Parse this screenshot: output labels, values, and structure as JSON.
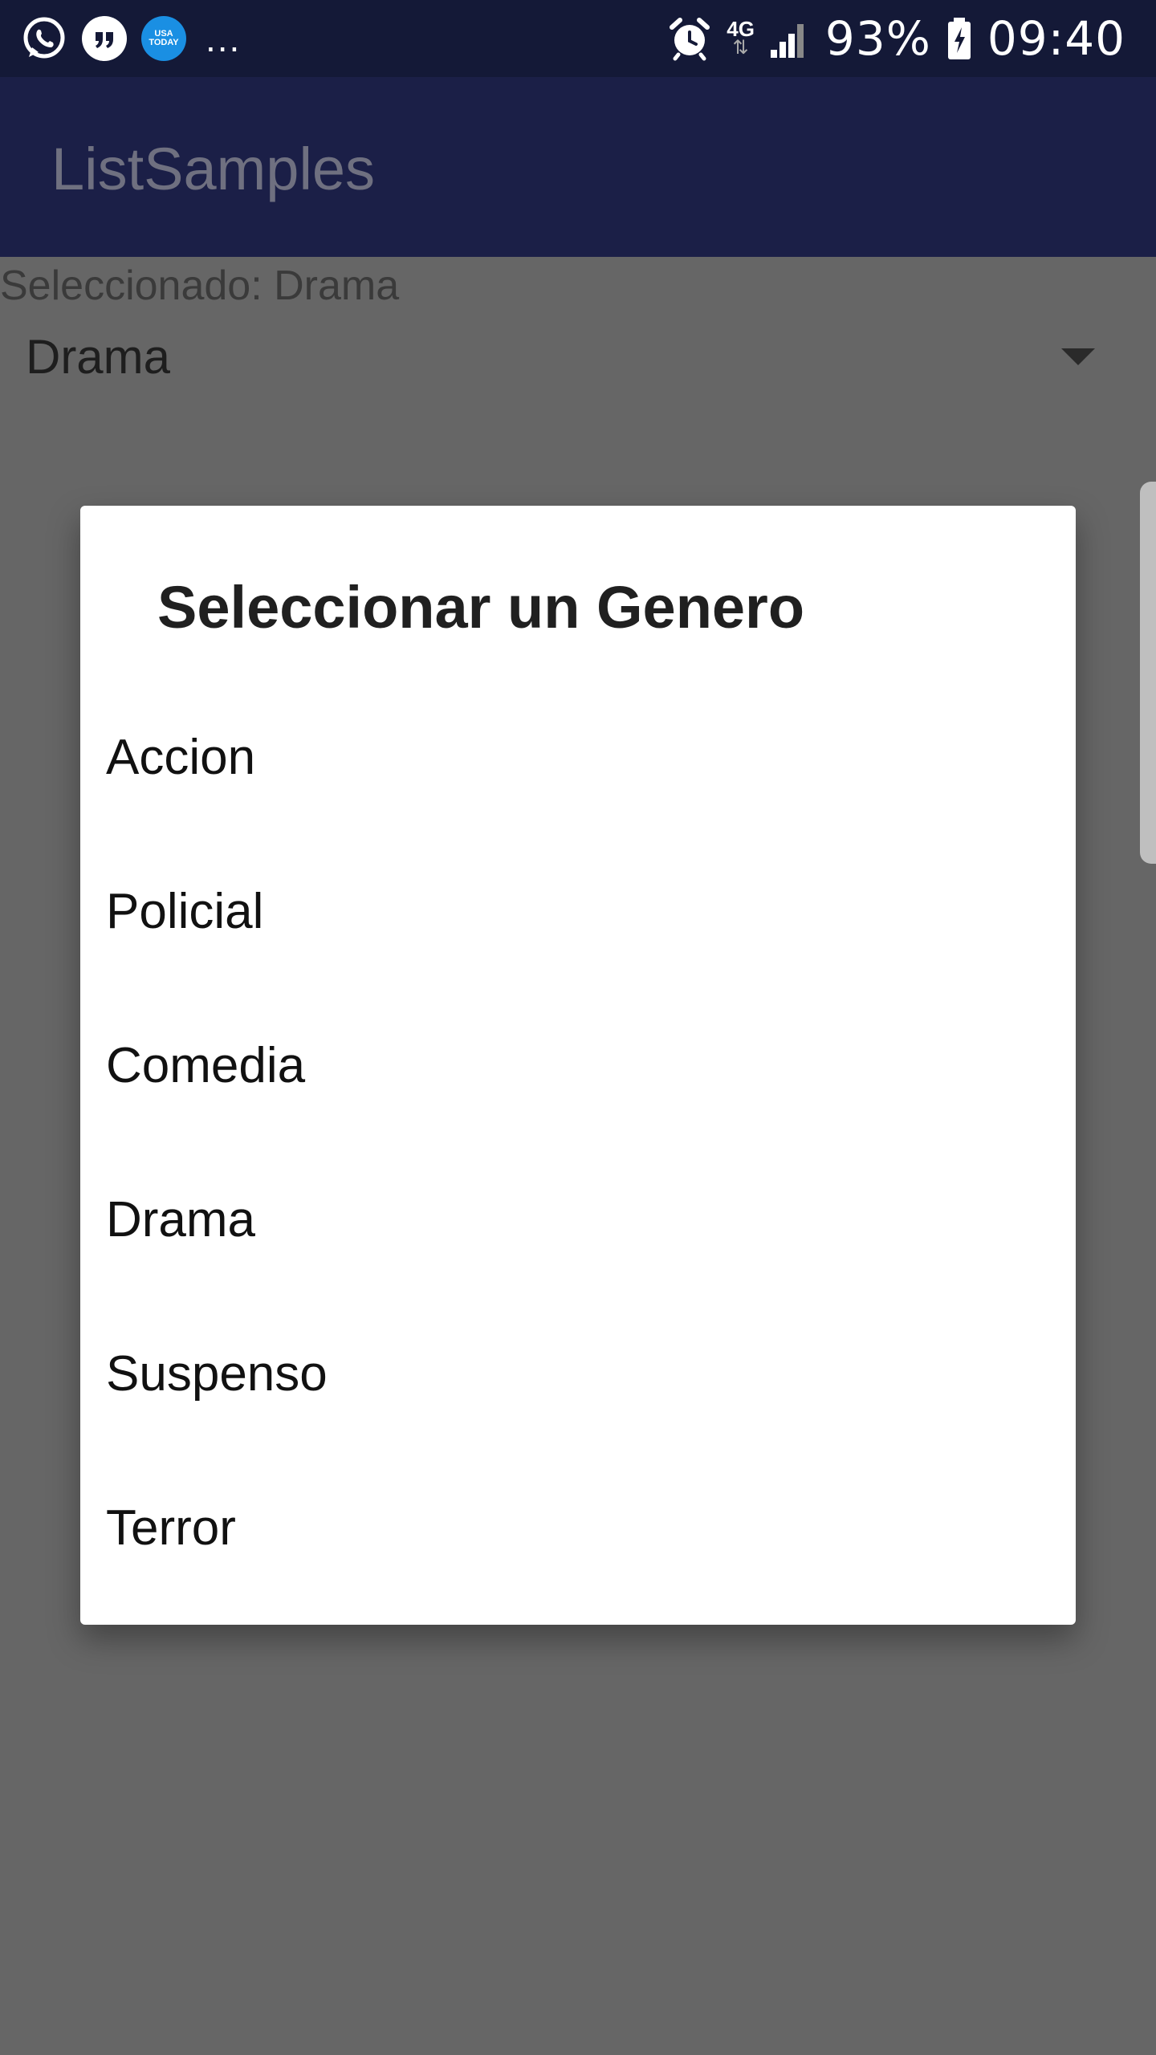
{
  "status_bar": {
    "icons": [
      "whatsapp-icon",
      "messenger-icon",
      "usa-today-icon",
      "more-notifications-icon",
      "alarm-icon",
      "network-4g-icon",
      "signal-icon",
      "battery-icon"
    ],
    "usa_today_text": "USA TODAY",
    "more": "...",
    "network": "4G",
    "battery": "93%",
    "time": "09:40"
  },
  "appbar": {
    "title": "ListSamples"
  },
  "content": {
    "selected_label": "Seleccionado: Drama",
    "spinner_value": "Drama"
  },
  "dialog": {
    "title": "Seleccionar un Genero",
    "options": [
      "Accion",
      "Policial",
      "Comedia",
      "Drama",
      "Suspenso",
      "Terror"
    ]
  },
  "colors": {
    "status_bar": "#141937",
    "app_bar": "#1b1f47",
    "scrim": "#666666",
    "dialog_bg": "#ffffff"
  }
}
